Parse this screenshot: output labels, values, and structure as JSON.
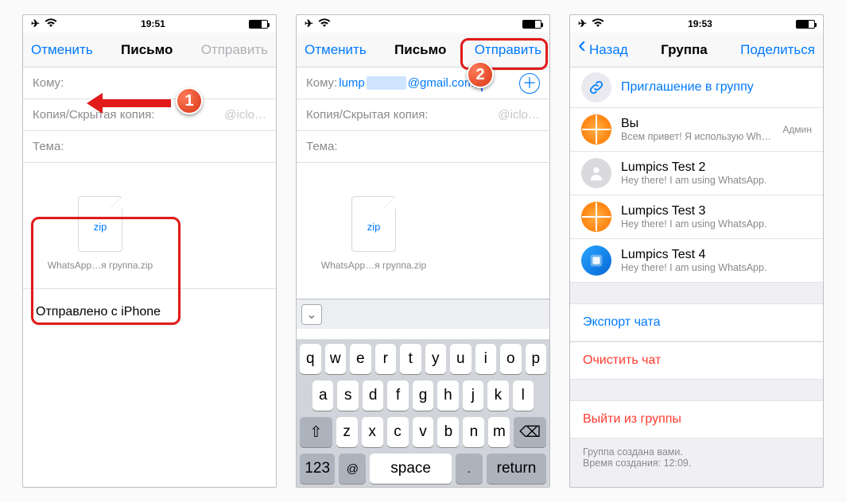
{
  "status": {
    "time1": "19:51",
    "time2": "",
    "time3": "19:53"
  },
  "panel1": {
    "nav": {
      "cancel": "Отменить",
      "title": "Письмо",
      "send": "Отправить"
    },
    "fields": {
      "to_label": "Кому:",
      "cc_label": "Копия/Скрытая копия:",
      "cc_value": "@iclo…",
      "subject_label": "Тема:"
    },
    "attachment_name": "WhatsApp…я группа.zip",
    "zip_tag": "zip",
    "signature": "Отправлено с iPhone"
  },
  "panel2": {
    "nav": {
      "cancel": "Отменить",
      "title": "Письмо",
      "send": "Отправить"
    },
    "fields": {
      "to_label": "Кому:",
      "to_value_prefix": "lump",
      "to_value_suffix": "@gmail.com,",
      "cc_label": "Копия/Скрытая копия:",
      "cc_value": "@iclo…",
      "subject_label": "Тема:"
    },
    "attachment_name": "WhatsApp…я группа.zip",
    "zip_tag": "zip",
    "keyboard": {
      "row1": [
        "q",
        "w",
        "e",
        "r",
        "t",
        "y",
        "u",
        "i",
        "o",
        "p"
      ],
      "row2": [
        "a",
        "s",
        "d",
        "f",
        "g",
        "h",
        "j",
        "k",
        "l"
      ],
      "row3_mid": [
        "z",
        "x",
        "c",
        "v",
        "b",
        "n",
        "m"
      ],
      "numKey": "123",
      "atKey": "@",
      "dotKey": ".",
      "spaceKey": "space",
      "returnKey": "return"
    }
  },
  "panel3": {
    "nav": {
      "back": "Назад",
      "title": "Группа",
      "share": "Поделиться"
    },
    "invite": "Приглашение в группу",
    "members": [
      {
        "name": "Вы",
        "sub": "Всем привет! Я использую Wh…",
        "meta": "Админ",
        "avatar": "orange"
      },
      {
        "name": "Lumpics Test 2",
        "sub": "Hey there! I am using WhatsApp.",
        "meta": "",
        "avatar": "person"
      },
      {
        "name": "Lumpics Test 3",
        "sub": "Hey there! I am using WhatsApp.",
        "meta": "",
        "avatar": "orange"
      },
      {
        "name": "Lumpics Test 4",
        "sub": "Hey there! I am using WhatsApp.",
        "meta": "",
        "avatar": "cube"
      }
    ],
    "actions": {
      "export": "Экспорт чата",
      "clear": "Очистить чат",
      "leave": "Выйти из группы"
    },
    "footer": {
      "l1": "Группа создана вами.",
      "l2": "Время создания: 12:09."
    }
  },
  "marks": {
    "n1": "1",
    "n2": "2"
  }
}
